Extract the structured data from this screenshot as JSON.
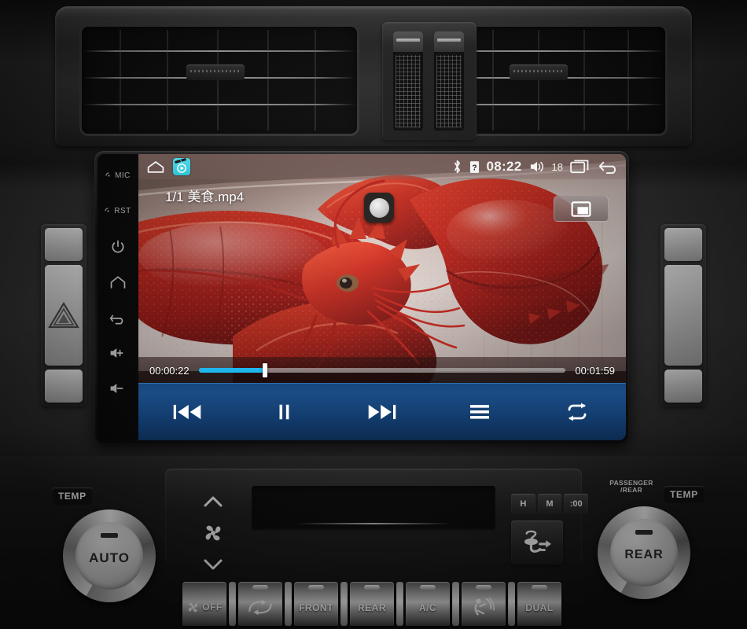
{
  "device": {
    "type": "car-head-unit",
    "hardware_keys": [
      {
        "name": "mic",
        "label": "MIC"
      },
      {
        "name": "reset",
        "label": "RST"
      },
      {
        "name": "power",
        "label": ""
      },
      {
        "name": "home",
        "label": ""
      },
      {
        "name": "back",
        "label": ""
      },
      {
        "name": "volume-up",
        "label": "+"
      },
      {
        "name": "volume-down",
        "label": "-"
      }
    ]
  },
  "statusbar": {
    "home_icon": "home-outline-icon",
    "app_icon": "video-app-icon",
    "bluetooth_icon": "bluetooth-icon",
    "sim_icon": "sim-card-icon",
    "time": "08:22",
    "volume_icon": "volume-icon",
    "volume_level": "18",
    "recents_icon": "recent-apps-icon",
    "back_icon": "back-arrow-icon"
  },
  "player": {
    "title": "1/1 美食.mp4",
    "pip_label": "",
    "pip_icon": "picture-in-picture-icon",
    "current_time": "00:00:22",
    "total_time": "00:01:59",
    "progress_percent": 18,
    "accent_color": "#1fb6ec",
    "controlbar_color": "#16477f",
    "controls": [
      {
        "name": "previous-button",
        "icon": "skip-previous-icon",
        "label": ""
      },
      {
        "name": "pause-button",
        "icon": "pause-icon",
        "label": ""
      },
      {
        "name": "next-button",
        "icon": "skip-next-icon",
        "label": ""
      },
      {
        "name": "playlist-button",
        "icon": "playlist-icon",
        "label": ""
      },
      {
        "name": "repeat-button",
        "icon": "repeat-icon",
        "label": ""
      }
    ]
  },
  "hvac": {
    "left_temp_tag": "TEMP",
    "right_temp_tag": "TEMP",
    "passenger_rear_tag": "PASSENGER\n/REAR",
    "left_knob_label": "AUTO",
    "right_knob_label": "REAR",
    "clock_buttons": [
      "H",
      "M",
      ":00"
    ],
    "strip_buttons": [
      {
        "name": "fan-off-button",
        "label": "OFF",
        "icon": "fan-icon"
      },
      {
        "name": "recirculation-button",
        "label": "",
        "icon": "recirculate-icon"
      },
      {
        "name": "front-defrost-button",
        "label": "FRONT",
        "icon": ""
      },
      {
        "name": "rear-defrost-button",
        "label": "REAR",
        "icon": ""
      },
      {
        "name": "ac-button",
        "label": "A/C",
        "icon": ""
      },
      {
        "name": "mode-button",
        "label": "",
        "icon": "airflow-mode-icon"
      },
      {
        "name": "dual-button",
        "label": "DUAL",
        "icon": ""
      }
    ],
    "fan_up_icon": "chevron-up-icon",
    "fan_icon": "fan-icon",
    "fan_down_icon": "chevron-down-icon",
    "vent_mode_icon": "defrost-airflow-icon"
  },
  "dashboard": {
    "hazard_icon": "hazard-triangle-icon",
    "left_vent": "air-vent-left",
    "right_vent": "air-vent-right",
    "camera_lens": "camera-lens"
  }
}
